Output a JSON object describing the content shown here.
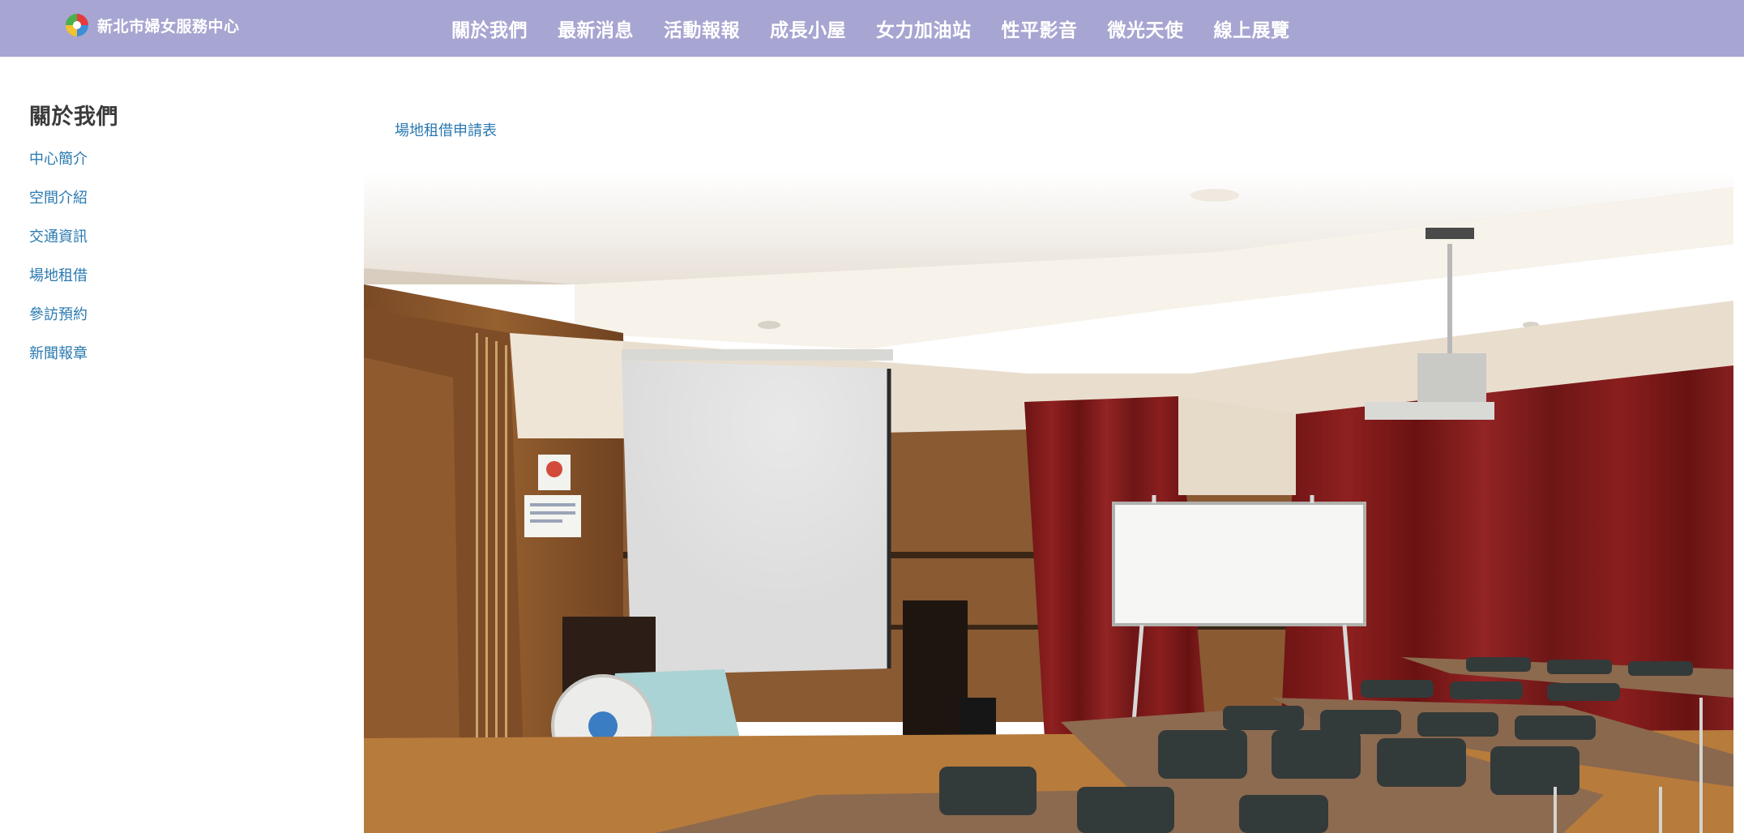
{
  "header": {
    "site_name": "新北市婦女服務中心",
    "logo_icon": "center-logo-icon",
    "nav_items": [
      "關於我們",
      "最新消息",
      "活動報報",
      "成長小屋",
      "女力加油站",
      "性平影音",
      "微光天使",
      "線上展覽"
    ]
  },
  "sidebar": {
    "title": "關於我們",
    "items": [
      "中心簡介",
      "空間介紹",
      "交通資訊",
      "場地租借",
      "參訪預約",
      "新聞報章"
    ]
  },
  "main": {
    "form_link": "場地租借申請表",
    "photo_icon": "meeting-room-photo"
  },
  "colors": {
    "header_bg": "#a7a5d1",
    "link": "#2a7ab0",
    "heading": "#3b3b3b"
  }
}
